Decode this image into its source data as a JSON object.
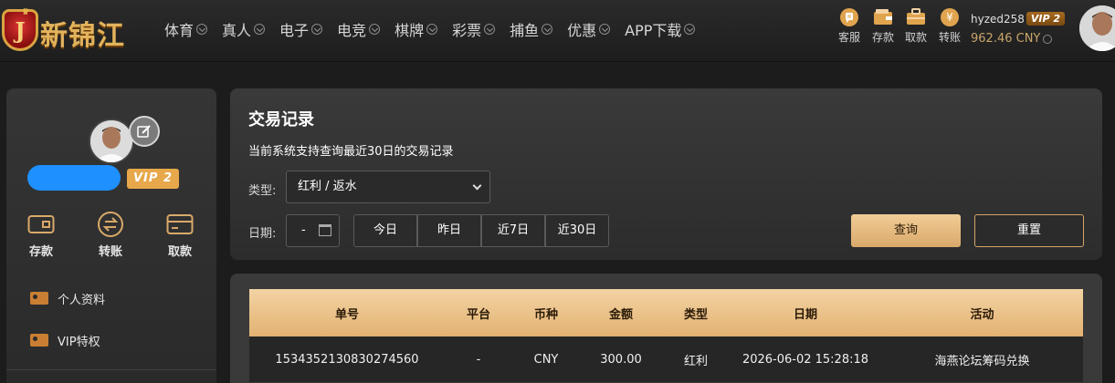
{
  "brand": {
    "badge_letter": "J",
    "name": "新锦江"
  },
  "nav": {
    "items": [
      {
        "label": "体育"
      },
      {
        "label": "真人"
      },
      {
        "label": "电子"
      },
      {
        "label": "电竞"
      },
      {
        "label": "棋牌"
      },
      {
        "label": "彩票"
      },
      {
        "label": "捕鱼"
      },
      {
        "label": "优惠"
      },
      {
        "label": "APP下载"
      }
    ]
  },
  "header_tools": {
    "service": "客服",
    "deposit": "存款",
    "withdraw": "取款",
    "transfer": "转账"
  },
  "user": {
    "username": "hyzed258",
    "vip": "VIP 2",
    "balance": "962.46 CNY"
  },
  "sidebar": {
    "vip": "VIP 2",
    "actions": [
      {
        "label": "存款",
        "icon": "wallet-icon"
      },
      {
        "label": "转账",
        "icon": "transfer-icon"
      },
      {
        "label": "取款",
        "icon": "card-icon"
      }
    ],
    "menu": [
      {
        "label": "个人资料",
        "icon": "profile-icon"
      },
      {
        "label": "VIP特权",
        "icon": "vip-icon"
      }
    ]
  },
  "records": {
    "title": "交易记录",
    "description": "当前系统支持查询最近30日的交易记录",
    "type_label": "类型:",
    "type_value": "红利 / 返水",
    "date_label": "日期:",
    "date_value": "-",
    "ranges": [
      "今日",
      "昨日",
      "近7日",
      "近30日"
    ],
    "query": "查询",
    "reset": "重置"
  },
  "table": {
    "headers": [
      "单号",
      "平台",
      "币种",
      "金额",
      "类型",
      "日期",
      "活动"
    ],
    "rows": [
      [
        "1534352130830274560",
        "-",
        "CNY",
        "300.00",
        "红利",
        "2026-06-02 15:28:18",
        "海燕论坛筹码兑换"
      ]
    ]
  },
  "colors": {
    "accent_gold": "#e2b272",
    "vip_orange": "#e7a84b",
    "masked_blue": "#1e90ff"
  }
}
